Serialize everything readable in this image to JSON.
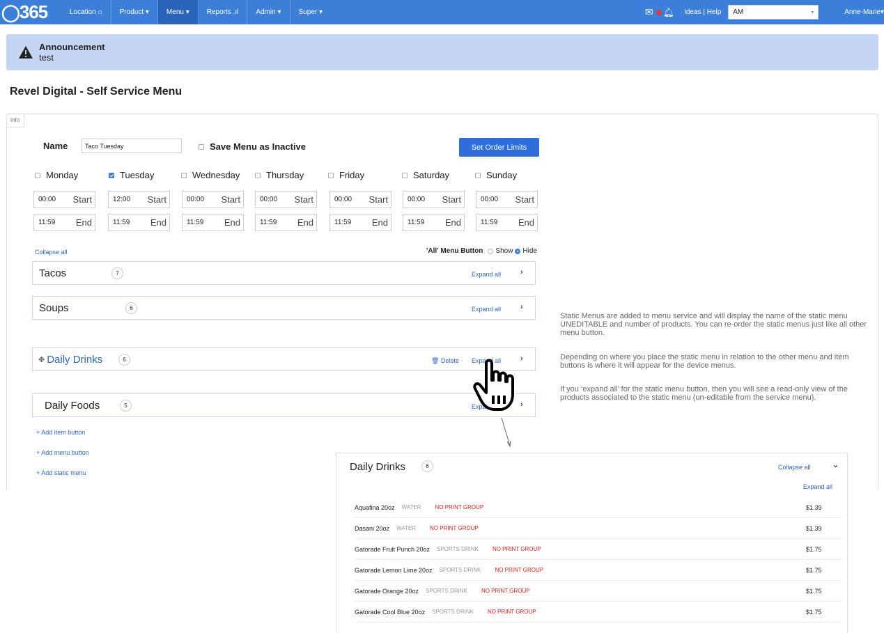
{
  "topnav": {
    "logo": "365",
    "items": [
      {
        "label": "Location",
        "icon": "home-icon"
      },
      {
        "label": "Product",
        "icon": "caret-down-icon"
      },
      {
        "label": "Menu",
        "icon": "caret-down-icon",
        "active": true
      },
      {
        "label": "Reports",
        "icon": "bar-chart-icon"
      },
      {
        "label": "Admin",
        "icon": "caret-down-icon"
      },
      {
        "label": "Super",
        "icon": "caret-down-icon"
      }
    ],
    "links": "Ideas | Help",
    "location_select": "AM",
    "user": "Anne-Marie"
  },
  "announcement": {
    "title": "Announcement",
    "body": "test"
  },
  "page": {
    "title": "Revel Digital - Self Service Menu",
    "info_tab": "Info"
  },
  "form": {
    "name_label": "Name",
    "name_value": "Taco Tuesday",
    "inactive_label": "Save Menu as Inactive",
    "set_limits_label": "Set Order Limits",
    "days": [
      {
        "label": "Monday",
        "checked": false,
        "start": "00:00",
        "end": "11:59"
      },
      {
        "label": "Tuesday",
        "checked": true,
        "start": "12:00",
        "end": "11:59"
      },
      {
        "label": "Wednesday",
        "checked": false,
        "start": "00:00",
        "end": "11:59"
      },
      {
        "label": "Thursday",
        "checked": false,
        "start": "00:00",
        "end": "11:59"
      },
      {
        "label": "Friday",
        "checked": false,
        "start": "00:00",
        "end": "11:59"
      },
      {
        "label": "Saturday",
        "checked": false,
        "start": "00:00",
        "end": "11:59"
      },
      {
        "label": "Sunday",
        "checked": false,
        "start": "00:00",
        "end": "11:59"
      }
    ],
    "start_tag": "Start",
    "end_tag": "End"
  },
  "menu_section": {
    "collapse_all": "Collapse all",
    "all_button_label": "'All' Menu Button",
    "show_label": "Show",
    "hide_label": "Hide",
    "selected": "Hide",
    "rows": [
      {
        "name": "Tacos",
        "count": "7",
        "expand": "Expand all"
      },
      {
        "name": "Soups",
        "count": "6",
        "expand": "Expand all"
      },
      {
        "name": "Daily Drinks",
        "count": "6",
        "expand": "Expand all",
        "delete": "Delete",
        "static": true
      },
      {
        "name": "Daily Foods",
        "count": "5",
        "expand": "Expand all"
      }
    ],
    "add_links": [
      "+ Add item button",
      "+ Add menu button",
      "+ Add static menu"
    ]
  },
  "help": {
    "p1": "Static Menus are added to menu service and will display the name of the static menu UNEDITABLE and number of products.  You can re-order the static menus just like all other menu button.",
    "p2": "Depending on where you place the static menu in relation to the other menu and item buttons is where it will appear for the device menus.",
    "p3": "If you ‘expand all’ for the static menu button, then you will see a read-only view of the products associated to the static menu (un-editable from the service menu)."
  },
  "detail": {
    "title": "Daily Drinks",
    "count": "6",
    "collapse_all": "Collapse all",
    "expand_all": "Expand all",
    "products": [
      {
        "name": "Aquafina 20oz",
        "category": "WATER",
        "group": "NO PRINT GROUP",
        "price": "$1.39"
      },
      {
        "name": "Dasani 20oz",
        "category": "WATER",
        "group": "NO PRINT GROUP",
        "price": "$1.39"
      },
      {
        "name": "Gatorade Fruit Punch 20oz",
        "category": "SPORTS DRINK",
        "group": "NO PRINT GROUP",
        "price": "$1.75"
      },
      {
        "name": "Gatorade Lemon Lime 20oz",
        "category": "SPORTS DRINK",
        "group": "NO PRINT GROUP",
        "price": "$1.75"
      },
      {
        "name": "Gatorade Orange 20oz",
        "category": "SPORTS DRINK",
        "group": "NO PRINT GROUP",
        "price": "$1.75"
      },
      {
        "name": "Gatorade Cool Blue 20oz",
        "category": "SPORTS DRINK",
        "group": "NO PRINT GROUP",
        "price": "$1.75"
      }
    ]
  },
  "colors": {
    "nav": "#3b7fd9",
    "accent": "#2f6ddb",
    "announcement": "#c5d6f5",
    "warning_text": "#e02020"
  }
}
